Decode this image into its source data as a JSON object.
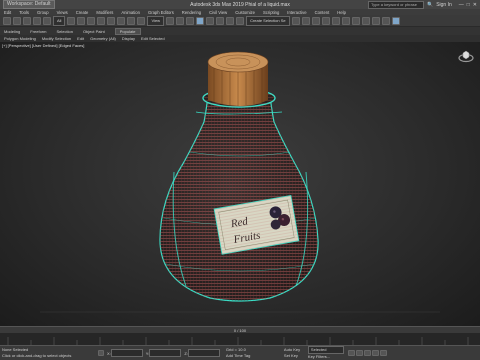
{
  "window": {
    "workspace": "Workspace: Default",
    "title": "Autodesk 3ds Max 2019   Phial of a liquid.max",
    "search_placeholder": "Type a keyword or phrase",
    "sign_in": "Sign In"
  },
  "menu": [
    "Edit",
    "Tools",
    "Group",
    "Views",
    "Create",
    "Modifiers",
    "Animation",
    "Graph Editors",
    "Rendering",
    "Civil View",
    "Customize",
    "Scripting",
    "Interactive",
    "Content",
    "Help"
  ],
  "toolbar": {
    "filter_value": "All",
    "view_value": "View",
    "selection_set_value": "Create Selection Se"
  },
  "ribbon": {
    "tabs": [
      "Modeling",
      "Freeform",
      "Selection",
      "Object Paint",
      "Populate"
    ],
    "row2": [
      "Polygon Modeling",
      "Modify Selection",
      "Edit",
      "Geometry (All)",
      "Display",
      "Edit Selected"
    ]
  },
  "viewport": {
    "label": "[+] [Perspective] [User Defined] [Edged Faces]",
    "label_line1": "Polygon Modeling",
    "label_text1": "Red",
    "label_text2": "Fruits"
  },
  "timeslider": {
    "position": "0 / 100"
  },
  "status": {
    "selection": "None Selected",
    "prompt": "Click or click-and-drag to select objects",
    "coord_x": "X:",
    "coord_y": "Y:",
    "coord_z": "Z:",
    "grid": "Grid = 10.0",
    "add_time_tag": "Add Time Tag",
    "auto_key": "Auto Key",
    "set_key": "Set Key",
    "selected": "Selected",
    "key_filters": "Key Filters..."
  }
}
